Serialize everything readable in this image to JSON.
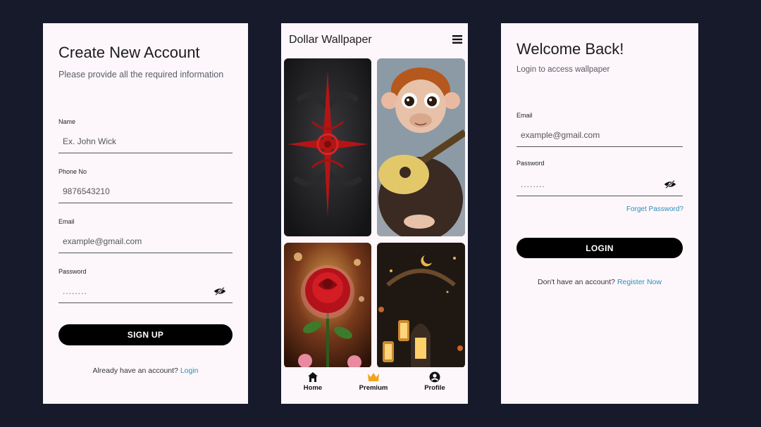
{
  "signup": {
    "title": "Create New Account",
    "subtitle": "Please provide all the required information",
    "name_label": "Name",
    "name_placeholder": "Ex. John Wick",
    "phone_label": "Phone No",
    "phone_placeholder": "9876543210",
    "email_label": "Email",
    "email_placeholder": "example@gmail.com",
    "password_label": "Password",
    "password_value": "........",
    "button_label": "SIGN UP",
    "footer_text": "Already have an account?",
    "footer_link": "Login"
  },
  "wallpaper": {
    "app_title": "Dollar Wallpaper",
    "nav": [
      {
        "label": "Home",
        "icon": "home-icon"
      },
      {
        "label": "Premium",
        "icon": "crown-icon"
      },
      {
        "label": "Profile",
        "icon": "account-circle-icon"
      }
    ],
    "premium_color": "#f2a51a"
  },
  "login": {
    "title": "Welcome Back!",
    "subtitle": "Login to access wallpaper",
    "email_label": "Email",
    "email_placeholder": "example@gmail.com",
    "password_label": "Password",
    "password_value": "........",
    "forgot_link": "Forget Password?",
    "button_label": "LOGIN",
    "footer_text": "Don't have an account?",
    "footer_link": "Register Now"
  },
  "colors": {
    "background": "#161a2b",
    "screen": "#fdf7fb",
    "button": "#000000",
    "link": "#2b8fb8"
  }
}
